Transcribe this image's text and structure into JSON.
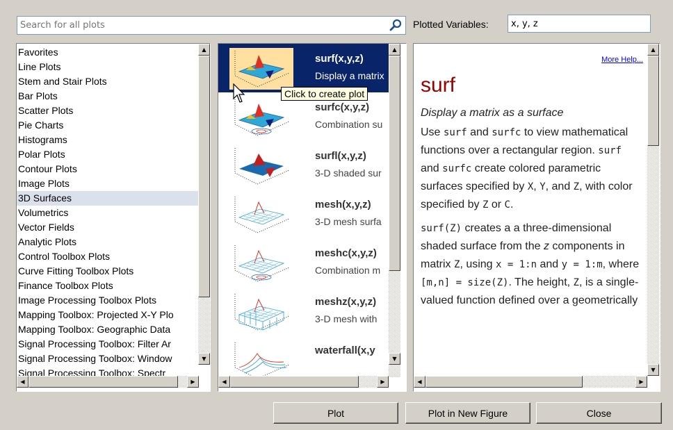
{
  "search": {
    "placeholder": "Search for all plots",
    "icon": "search-icon"
  },
  "plotted_variables": {
    "label": "Plotted Variables:",
    "value": "x, y, z"
  },
  "categories": [
    {
      "label": "Favorites"
    },
    {
      "label": "Line Plots"
    },
    {
      "label": "Stem and Stair Plots"
    },
    {
      "label": "Bar Plots"
    },
    {
      "label": "Scatter Plots"
    },
    {
      "label": "Pie Charts"
    },
    {
      "label": "Histograms"
    },
    {
      "label": "Polar Plots"
    },
    {
      "label": "Contour Plots"
    },
    {
      "label": "Image Plots"
    },
    {
      "label": "3D Surfaces",
      "selected": true
    },
    {
      "label": "Volumetrics"
    },
    {
      "label": "Vector Fields"
    },
    {
      "label": "Analytic Plots"
    },
    {
      "label": "Control Toolbox Plots"
    },
    {
      "label": "Curve Fitting Toolbox Plots"
    },
    {
      "label": "Finance Toolbox Plots"
    },
    {
      "label": "Image Processing Toolbox Plots"
    },
    {
      "label": "Mapping Toolbox: Projected X-Y Plo"
    },
    {
      "label": "Mapping Toolbox: Geographic Data"
    },
    {
      "label": "Signal Processing Toolbox: Filter Ar"
    },
    {
      "label": "Signal Processing Toolbox: Window"
    },
    {
      "label": "Signal Processing Toolbox: Spectr"
    }
  ],
  "plots": [
    {
      "name": "surf(x,y,z)",
      "desc": "Display a matrix",
      "selected": true,
      "style": "surf"
    },
    {
      "name": "surfc(x,y,z)",
      "desc": "Combination su",
      "style": "surfc"
    },
    {
      "name": "surfl(x,y,z)",
      "desc": "3-D shaded sur",
      "style": "surfl"
    },
    {
      "name": "mesh(x,y,z)",
      "desc": "3-D mesh surfa",
      "style": "mesh"
    },
    {
      "name": "meshc(x,y,z)",
      "desc": "Combination m",
      "style": "meshc"
    },
    {
      "name": "meshz(x,y,z)",
      "desc": "3-D mesh with",
      "style": "meshz"
    },
    {
      "name": "waterfall(x,y",
      "desc": "",
      "style": "waterfall"
    }
  ],
  "tooltip": "Click to create plot",
  "help": {
    "more_help": "More Help...",
    "title": "surf",
    "subtitle": "Display a matrix as a surface",
    "p1": {
      "t1": "Use ",
      "c1": "surf",
      "t2": " and ",
      "c2": "surfc",
      "t3": " to view mathematical functions over a rectangular region. ",
      "c3": "surf",
      "t4": " and ",
      "c4": "surfc",
      "t5": " create colored parametric surfaces specified by ",
      "c5": "X",
      "t6": ", ",
      "c6": "Y",
      "t7": ", and ",
      "c7": "Z",
      "t8": ", with color specified by ",
      "c8": "Z",
      "t9": " or ",
      "c9": "C",
      "t10": "."
    },
    "p2": {
      "c1": "surf(Z)",
      "t1": "  creates a a three-dimensional shaded surface from the ",
      "i1": "z",
      "t2": " components in matrix ",
      "c2": "Z",
      "t3": ", using ",
      "c3": "x = 1:n",
      "t4": " and ",
      "c4": "y = 1:m",
      "t5": ", where ",
      "c5": "[m,n] = size(Z)",
      "t6": ". The height, ",
      "c6": "Z",
      "t7": ", is a single-valued function defined over a geometrically"
    }
  },
  "buttons": {
    "plot": "Plot",
    "plot_new": "Plot in New Figure",
    "close": "Close"
  },
  "colors": {
    "selection": "#0a246a",
    "category_selected": "#dbe1ec",
    "help_title": "#990000",
    "link": "#0000ff"
  }
}
